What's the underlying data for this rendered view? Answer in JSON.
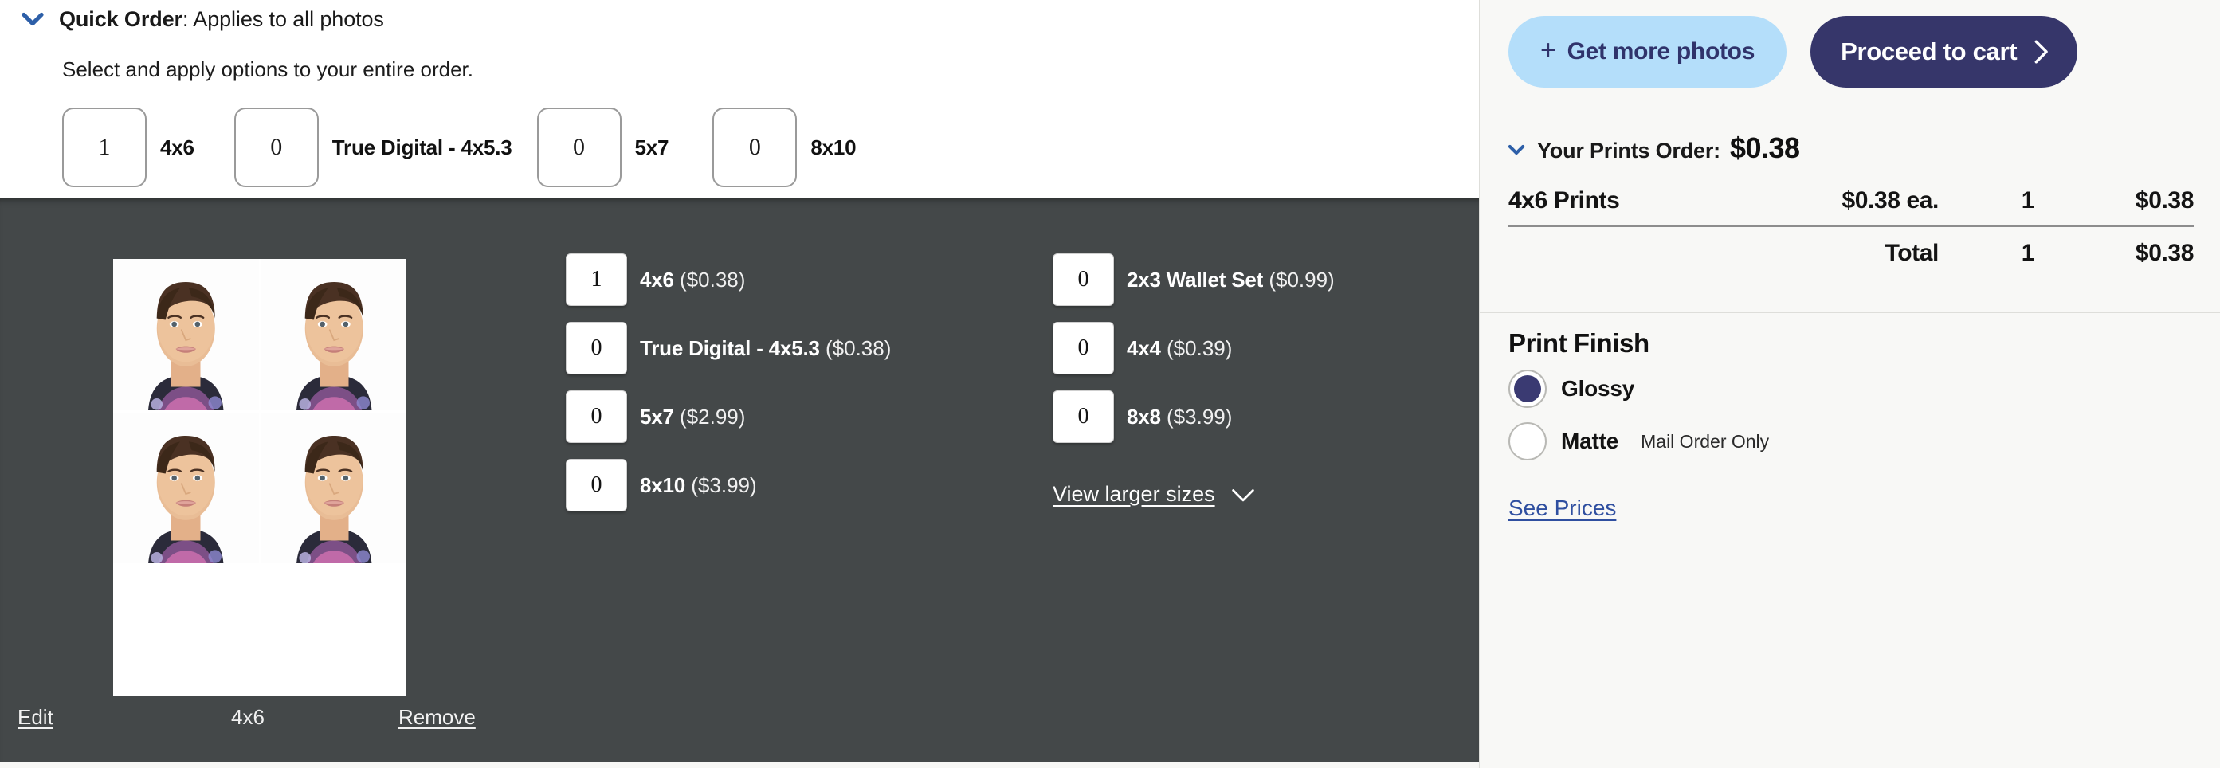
{
  "quick_order": {
    "chevron_icon": "chevron-down-icon",
    "title_bold": "Quick Order",
    "title_rest": ": Applies to all photos",
    "subtitle": "Select and apply options to your entire order.",
    "items": [
      {
        "value": "1",
        "label": "4x6"
      },
      {
        "value": "0",
        "label": "True Digital - 4x5.3"
      },
      {
        "value": "0",
        "label": "5x7"
      },
      {
        "value": "0",
        "label": "8x10"
      }
    ]
  },
  "photo": {
    "edit_label": "Edit",
    "size_label": "4x6",
    "remove_label": "Remove"
  },
  "print_options": {
    "column_left": [
      {
        "value": "1",
        "name": "4x6",
        "price": "($0.38)"
      },
      {
        "value": "0",
        "name": "True Digital - 4x5.3",
        "price": "($0.38)"
      },
      {
        "value": "0",
        "name": "5x7",
        "price": "($2.99)"
      },
      {
        "value": "0",
        "name": "8x10",
        "price": "($3.99)"
      }
    ],
    "column_right": [
      {
        "value": "0",
        "name": "2x3 Wallet Set",
        "price": "($0.99)"
      },
      {
        "value": "0",
        "name": "4x4",
        "price": "($0.39)"
      },
      {
        "value": "0",
        "name": "8x8",
        "price": "($3.99)"
      }
    ],
    "view_larger_label": "View larger sizes",
    "view_larger_icon": "chevron-down-icon"
  },
  "sidebar": {
    "get_more_photos_label": "Get more photos",
    "get_more_photos_icon": "plus-icon",
    "proceed_label": "Proceed to cart",
    "proceed_icon": "chevron-right-icon",
    "order": {
      "chevron_icon": "chevron-down-icon",
      "heading_label": "Your Prints Order:",
      "heading_amount": "$0.38",
      "rows": [
        {
          "name": "4x6 Prints",
          "each": "$0.38 ea.",
          "qty": "1",
          "total": "$0.38"
        }
      ],
      "summary": {
        "name": "",
        "each": "Total",
        "qty": "1",
        "total": "$0.38"
      }
    },
    "finish": {
      "title": "Print Finish",
      "options": [
        {
          "label": "Glossy",
          "note": "",
          "selected": true
        },
        {
          "label": "Matte",
          "note": "Mail Order Only",
          "selected": false
        }
      ],
      "see_prices_label": "See Prices"
    }
  },
  "colors": {
    "accent_blue": "#2d5fa8",
    "dark_panel": "#444849",
    "sidebar_bg": "#f8f8f6",
    "primary_button": "#36366a",
    "secondary_button": "#b4defa",
    "link": "#2f4fa0"
  }
}
